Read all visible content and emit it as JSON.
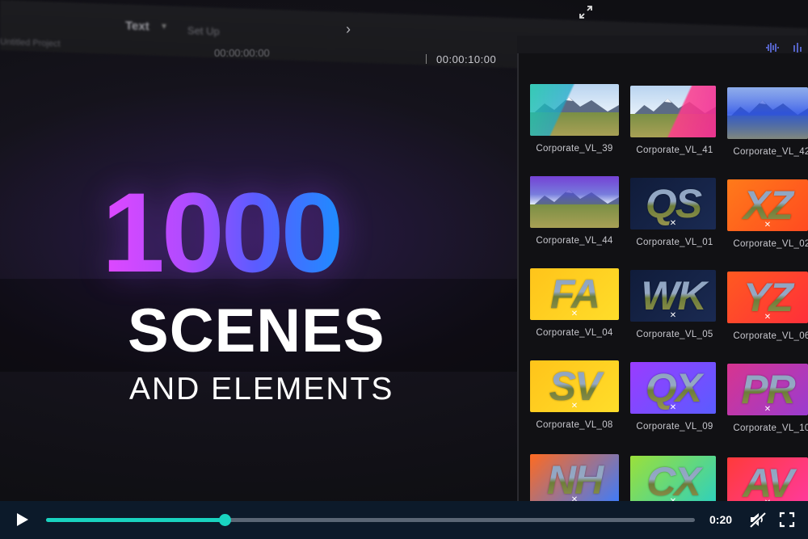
{
  "app": {
    "menu_label": "Text",
    "menu_label2": "Set Up",
    "sub_label": "Untitled Project",
    "timecode_left": "00:00:00:00",
    "timecode_right": "00:00:10:00"
  },
  "hero": {
    "number": "1000",
    "line1": "SCENES",
    "line2": "AND ELEMENTS"
  },
  "browser": {
    "items": [
      {
        "caption": "Corporate_VL_39",
        "letters": "",
        "style": "teal-left"
      },
      {
        "caption": "Corporate_VL_41",
        "letters": "",
        "style": "pink-right"
      },
      {
        "caption": "Corporate_VL_42",
        "letters": "",
        "style": "blue-band"
      },
      {
        "caption": "Corporate_VL_44",
        "letters": "",
        "style": "purple-top"
      },
      {
        "caption": "Corporate_VL_01",
        "letters": "QS",
        "style": "dark-navy"
      },
      {
        "caption": "Corporate_VL_02",
        "letters": "XZ",
        "style": "orange"
      },
      {
        "caption": "Corporate_VL_04",
        "letters": "FA",
        "style": "yellow"
      },
      {
        "caption": "Corporate_VL_05",
        "letters": "WK",
        "style": "dark-navy"
      },
      {
        "caption": "Corporate_VL_06",
        "letters": "YZ",
        "style": "orange-red"
      },
      {
        "caption": "Corporate_VL_08",
        "letters": "SV",
        "style": "yellow"
      },
      {
        "caption": "Corporate_VL_09",
        "letters": "QX",
        "style": "purple-blue"
      },
      {
        "caption": "Corporate_VL_10",
        "letters": "PR",
        "style": "pink-purple"
      },
      {
        "caption": "",
        "letters": "NH",
        "style": "orange-blue"
      },
      {
        "caption": "",
        "letters": "CX",
        "style": "green-blue"
      },
      {
        "caption": "",
        "letters": "AV",
        "style": "red-pink"
      }
    ]
  },
  "player": {
    "time": "0:20",
    "progress": 0.275,
    "accent": "#19d3c0",
    "icons": [
      "play-icon",
      "mute-icon",
      "fullscreen-icon",
      "expand-icon",
      "chevron-right-icon"
    ]
  }
}
